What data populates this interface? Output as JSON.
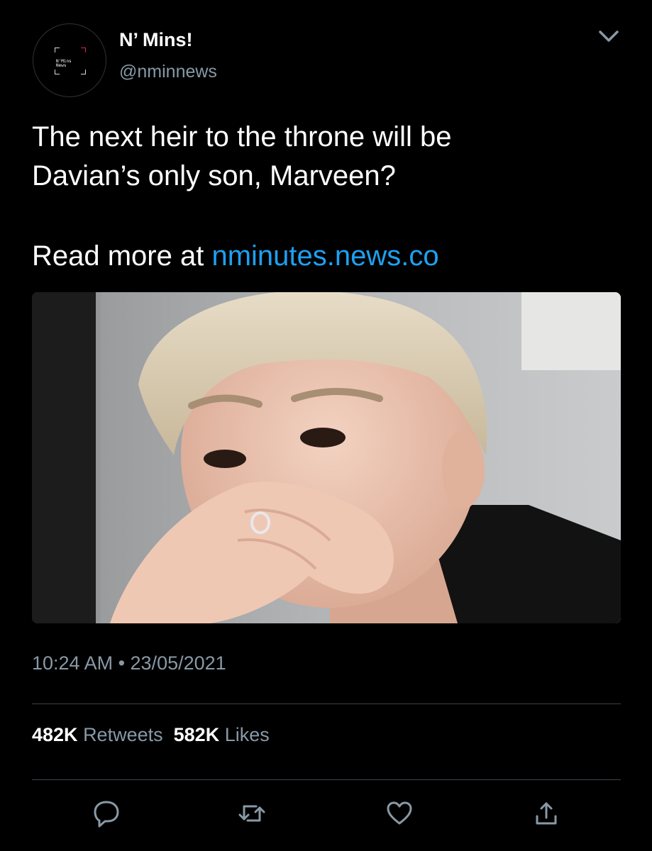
{
  "account": {
    "display_name": "N’ Mins!",
    "handle": "@nminnews",
    "avatar_text": "N'Mins\nNews"
  },
  "tweet": {
    "text_line1": "The next heir to the throne will be",
    "text_line2": "Davian’s only son, Marveen?",
    "read_more_prefix": "Read more at ",
    "link": "nminutes.news.co",
    "timestamp": "10:24 AM • 23/05/2021"
  },
  "stats": {
    "retweets_count": "482K",
    "retweets_label": "Retweets",
    "likes_count": "582K",
    "likes_label": "Likes"
  },
  "icons": {
    "menu": "chevron-down-icon",
    "actions": [
      "reply-icon",
      "retweet-icon",
      "like-icon",
      "share-icon"
    ]
  },
  "colors": {
    "background": "#000000",
    "link": "#1da1f2",
    "secondary_text": "#8899a6",
    "divider": "#38444d"
  }
}
